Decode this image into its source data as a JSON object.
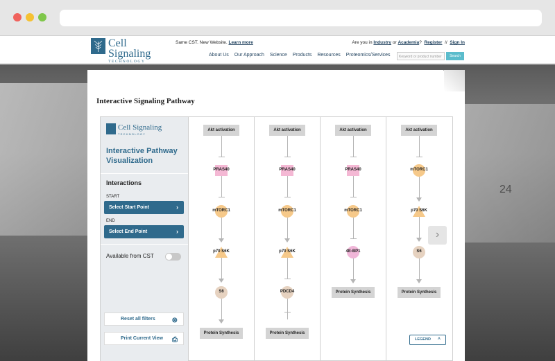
{
  "header": {
    "logo_line1": "Cell Signaling",
    "logo_line2": "TECHNOLOGY",
    "promo_text": "Same CST. New Website.",
    "promo_link": "Learn more",
    "account_prefix": "Are you in",
    "industry": "Industry",
    "or": "or",
    "academia": "Academia",
    "qmark": "?",
    "register": "Register",
    "divider": "//",
    "sign_in": "Sign In",
    "nav": [
      "About Us",
      "Our Approach",
      "Science",
      "Products",
      "Resources",
      "Proteomics/Services"
    ],
    "search_placeholder": "Keyword or product number",
    "search_button": "Search"
  },
  "page": {
    "title": "Interactive Signaling Pathway"
  },
  "sidebar": {
    "logo_line1": "Cell Signaling",
    "logo_line2": "TECHNOLOGY",
    "heading": "Interactive Pathway Visualization",
    "interactions": "Interactions",
    "start_label": "START",
    "start_button": "Select Start Point",
    "end_label": "END",
    "end_button": "Select End Point",
    "available": "Available from CST",
    "reset": "Reset all filters",
    "print": "Print Current View"
  },
  "pathways": [
    {
      "nodes": [
        "Akt activation",
        "PRAS40",
        "mTORC1",
        "p70 S6K",
        "S6",
        "Protein Synthesis"
      ]
    },
    {
      "nodes": [
        "Akt activation",
        "PRAS40",
        "mTORC1",
        "p70 S6K",
        "PDCD4",
        "Protein Synthesis"
      ]
    },
    {
      "nodes": [
        "Akt activation",
        "PRAS40",
        "mTORC1",
        "4E-BP1",
        "Protein Synthesis"
      ]
    },
    {
      "nodes": [
        "Akt activation",
        "mTORC1",
        "p70 S6K",
        "S6",
        "Protein Synthesis"
      ]
    }
  ],
  "legend": "LEGEND",
  "colors": {
    "brand": "#2f6a8c",
    "accent": "#5bbccc"
  }
}
